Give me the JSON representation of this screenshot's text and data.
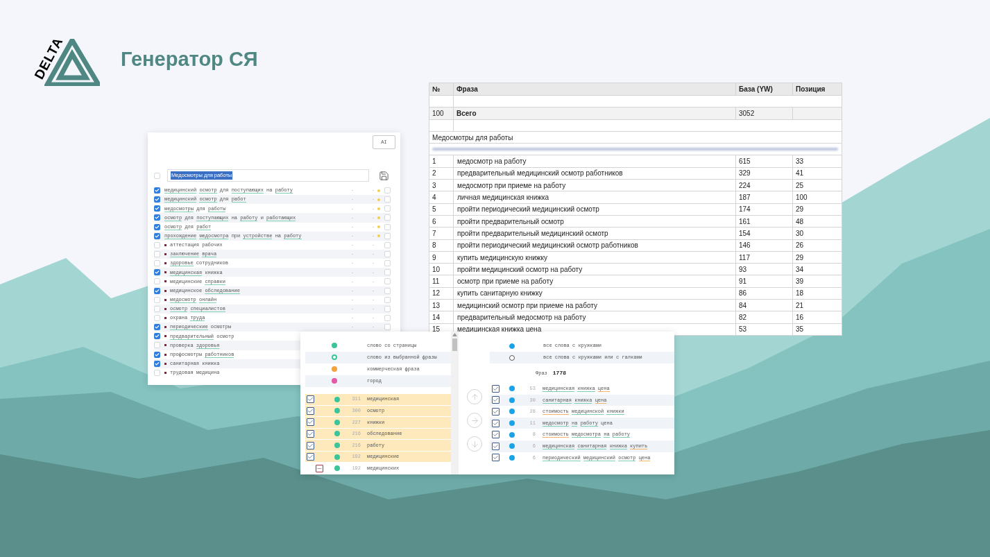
{
  "brand": {
    "logo_text": "DELTA",
    "title": "Генератор СЯ"
  },
  "phrase_editor": {
    "ai_button": "AI",
    "select_all_checked": false,
    "name_field": "Медосмотры для работы",
    "rows": [
      {
        "checked": true,
        "bullet": false,
        "words": [
          {
            "t": "медицинский",
            "color": "#7fd0b3"
          },
          {
            "t": "осмотр",
            "color": "#7fd0b3"
          },
          {
            "t": "для"
          },
          {
            "t": "поступающих",
            "color": "#7fd0b3"
          },
          {
            "t": "на"
          },
          {
            "t": "работу",
            "color": "#7fd0b3"
          }
        ],
        "column_3": "-",
        "column_4": "-",
        "dot": true,
        "flag_checked": false
      },
      {
        "checked": true,
        "bullet": false,
        "words": [
          {
            "t": "медицинский",
            "color": "#7fd0b3"
          },
          {
            "t": "осмотр",
            "color": "#7fd0b3"
          },
          {
            "t": "для"
          },
          {
            "t": "работ",
            "color": "#7fd0b3"
          }
        ],
        "column_3": "-",
        "column_4": "-",
        "dot": true,
        "flag_checked": false
      },
      {
        "checked": true,
        "bullet": false,
        "words": [
          {
            "t": "медосмотры",
            "color": "#7fd0b3"
          },
          {
            "t": "для"
          },
          {
            "t": "работы",
            "color": "#7fd0b3"
          }
        ],
        "column_3": "-",
        "column_4": "-",
        "dot": true,
        "flag_checked": false
      },
      {
        "checked": true,
        "bullet": false,
        "words": [
          {
            "t": "осмотр",
            "color": "#7fd0b3"
          },
          {
            "t": "для"
          },
          {
            "t": "поступающих",
            "color": "#7fd0b3"
          },
          {
            "t": "на"
          },
          {
            "t": "работу",
            "color": "#7fd0b3"
          },
          {
            "t": "и"
          },
          {
            "t": "работающих",
            "color": "#7fd0b3"
          }
        ],
        "column_3": "-",
        "column_4": "-",
        "dot": true,
        "flag_checked": false
      },
      {
        "checked": true,
        "bullet": false,
        "words": [
          {
            "t": "осмотр",
            "color": "#7fd0b3"
          },
          {
            "t": "для"
          },
          {
            "t": "работ",
            "color": "#7fd0b3"
          }
        ],
        "column_3": "-",
        "column_4": "-",
        "dot": true,
        "flag_checked": false
      },
      {
        "checked": true,
        "bullet": false,
        "words": [
          {
            "t": "прохождение",
            "color": "#7fd0b3"
          },
          {
            "t": "медосмотра",
            "color": "#7fd0b3"
          },
          {
            "t": "при"
          },
          {
            "t": "устройстве",
            "color": "#7fd0b3"
          },
          {
            "t": "на"
          },
          {
            "t": "работу",
            "color": "#7fd0b3"
          }
        ],
        "column_3": "-",
        "column_4": "-",
        "dot": true,
        "flag_checked": false
      },
      {
        "checked": false,
        "bullet": true,
        "words": [
          {
            "t": "аттестация"
          },
          {
            "t": "рабочих"
          }
        ],
        "column_3": "-",
        "column_4": "-",
        "dot": false,
        "flag_checked": false
      },
      {
        "checked": false,
        "bullet": true,
        "words": [
          {
            "t": "заключение",
            "color": "#7fd0b3"
          },
          {
            "t": "врача",
            "color": "#7fd0b3"
          }
        ],
        "column_3": "-",
        "column_4": "-",
        "dot": false,
        "flag_checked": false
      },
      {
        "checked": false,
        "bullet": true,
        "words": [
          {
            "t": "здоровье",
            "color": "#7fd0b3"
          },
          {
            "t": "сотрудников"
          }
        ],
        "column_3": "-",
        "column_4": "-",
        "dot": false,
        "flag_checked": false
      },
      {
        "checked": true,
        "bullet": true,
        "words": [
          {
            "t": "медицинская",
            "color": "#7fd0b3"
          },
          {
            "t": "книжка"
          }
        ],
        "column_3": "-",
        "column_4": "-",
        "dot": false,
        "flag_checked": false
      },
      {
        "checked": false,
        "bullet": true,
        "words": [
          {
            "t": "медицинские"
          },
          {
            "t": "справки",
            "color": "#7fd0b3"
          }
        ],
        "column_3": "-",
        "column_4": "-",
        "dot": false,
        "flag_checked": false
      },
      {
        "checked": true,
        "bullet": true,
        "words": [
          {
            "t": "медицинское"
          },
          {
            "t": "обследование",
            "color": "#7fd0b3"
          }
        ],
        "column_3": "-",
        "column_4": "-",
        "dot": false,
        "flag_checked": false
      },
      {
        "checked": false,
        "bullet": true,
        "words": [
          {
            "t": "медосмотр",
            "color": "#7fd0b3"
          },
          {
            "t": "онлайн",
            "color": "#7fd0b3"
          }
        ],
        "column_3": "-",
        "column_4": "-",
        "dot": false,
        "flag_checked": false
      },
      {
        "checked": false,
        "bullet": true,
        "words": [
          {
            "t": "осмотр",
            "color": "#7fd0b3"
          },
          {
            "t": "специалистов",
            "color": "#7fd0b3"
          }
        ],
        "column_3": "-",
        "column_4": "-",
        "dot": false,
        "flag_checked": false
      },
      {
        "checked": false,
        "bullet": true,
        "words": [
          {
            "t": "охрана"
          },
          {
            "t": "труда",
            "color": "#7fd0b3"
          }
        ],
        "column_3": "-",
        "column_4": "-",
        "dot": false,
        "flag_checked": false
      },
      {
        "checked": true,
        "bullet": true,
        "words": [
          {
            "t": "периодические",
            "color": "#7fd0b3"
          },
          {
            "t": "осмотры"
          }
        ],
        "column_3": "-",
        "column_4": "-",
        "dot": false,
        "flag_checked": false
      },
      {
        "checked": true,
        "bullet": true,
        "words": [
          {
            "t": "предварительный",
            "color": "#7fd0b3"
          },
          {
            "t": "осмотр"
          }
        ]
      },
      {
        "checked": false,
        "bullet": true,
        "words": [
          {
            "t": "проверка"
          },
          {
            "t": "здоровья",
            "color": "#7fd0b3"
          }
        ]
      },
      {
        "checked": true,
        "bullet": true,
        "words": [
          {
            "t": "профосмотры"
          },
          {
            "t": "работников",
            "color": "#7fd0b3"
          }
        ]
      },
      {
        "checked": true,
        "bullet": true,
        "words": [
          {
            "t": "санитарная"
          },
          {
            "t": "книжка"
          }
        ]
      },
      {
        "checked": false,
        "bullet": true,
        "words": [
          {
            "t": "трудовая"
          },
          {
            "t": "медицина"
          }
        ]
      }
    ]
  },
  "results_table": {
    "columns": [
      "№",
      "Фраза",
      "База (YW)",
      "Позиция"
    ],
    "rows": [
      {
        "kind": "blank"
      },
      {
        "kind": "total",
        "cells": [
          "100",
          "Всего",
          "3052"
        ]
      },
      {
        "kind": "blank"
      },
      {
        "kind": "group",
        "text": "Медосмотры для работы"
      },
      {
        "kind": "blurred"
      },
      {
        "kind": "data",
        "cells": [
          "1",
          "медосмотр на работу",
          "615",
          "33"
        ]
      },
      {
        "kind": "data",
        "cells": [
          "2",
          "предварительный медицинский осмотр работников",
          "329",
          "41"
        ]
      },
      {
        "kind": "data",
        "cells": [
          "3",
          "медосмотр при приеме на работу",
          "224",
          "25"
        ]
      },
      {
        "kind": "data",
        "cells": [
          "4",
          "личная медицинская книжка",
          "187",
          "100"
        ]
      },
      {
        "kind": "data",
        "cells": [
          "5",
          "пройти периодический медицинский осмотр",
          "174",
          "29"
        ]
      },
      {
        "kind": "data",
        "cells": [
          "6",
          "пройти предварительный осмотр",
          "161",
          "48"
        ]
      },
      {
        "kind": "data",
        "cells": [
          "7",
          "пройти предварительный медицинский осмотр",
          "154",
          "30"
        ]
      },
      {
        "kind": "data",
        "cells": [
          "8",
          "пройти периодический медицинский осмотр работников",
          "146",
          "26"
        ]
      },
      {
        "kind": "data",
        "cells": [
          "9",
          "купить медицинскую книжку",
          "117",
          "29"
        ]
      },
      {
        "kind": "data",
        "cells": [
          "10",
          "пройти медицинский осмотр на работу",
          "93",
          "34"
        ]
      },
      {
        "kind": "data",
        "cells": [
          "11",
          "осмотр при приеме на работу",
          "91",
          "39"
        ]
      },
      {
        "kind": "data",
        "cells": [
          "12",
          "купить санитарную книжку",
          "86",
          "18"
        ]
      },
      {
        "kind": "data",
        "cells": [
          "13",
          "медицинский осмотр при приеме на работу",
          "84",
          "21"
        ]
      },
      {
        "kind": "data",
        "cells": [
          "14",
          "предварительный медосмотр на работу",
          "82",
          "16"
        ]
      },
      {
        "kind": "data",
        "cells": [
          "15",
          "медицинская книжка цена",
          "53",
          "35"
        ]
      }
    ]
  },
  "word_panel": {
    "legend": [
      {
        "label": "слово со страницы",
        "color": "#3cc49a",
        "hollow": false
      },
      {
        "label": "слово из выбранной фразы",
        "color": "#3cc49a",
        "hollow": true
      },
      {
        "label": "коммерческая фраза",
        "color": "#f4a240",
        "hollow": false
      },
      {
        "label": "город",
        "color": "#e657a8",
        "hollow": false
      }
    ],
    "words": [
      {
        "checked": true,
        "highlighted": true,
        "count": "311",
        "word": "медицинская"
      },
      {
        "checked": true,
        "highlighted": true,
        "count": "300",
        "word": "осмотр"
      },
      {
        "checked": true,
        "highlighted": true,
        "count": "227",
        "word": "книжки"
      },
      {
        "checked": true,
        "highlighted": true,
        "count": "216",
        "word": "обследование"
      },
      {
        "checked": true,
        "highlighted": true,
        "count": "216",
        "word": "работу"
      },
      {
        "checked": true,
        "highlighted": true,
        "count": "192",
        "word": "медицинские"
      },
      {
        "indeterminate": true,
        "highlighted": false,
        "count": "192",
        "word": "медицинских"
      }
    ]
  },
  "phrase_panel": {
    "legend": [
      {
        "label": "все слова с кружками",
        "selected": true
      },
      {
        "label": "все слова с кружками или с галками",
        "selected": false
      }
    ],
    "count_label": "Фраз",
    "count": "1778",
    "rows": [
      {
        "checked": true,
        "count": "53",
        "words": [
          {
            "t": "медицинская",
            "color": "#7fd0b3"
          },
          {
            "t": "книжка",
            "color": "#7fd0b3"
          },
          {
            "t": "цена",
            "color": "#f0b46a"
          }
        ]
      },
      {
        "checked": true,
        "count": "30",
        "words": [
          {
            "t": "санитарная",
            "color": "#7fd0b3"
          },
          {
            "t": "книжка",
            "color": "#7fd0b3"
          },
          {
            "t": "цена",
            "color": "#f0b46a"
          }
        ]
      },
      {
        "checked": true,
        "count": "28",
        "words": [
          {
            "t": "стоимость",
            "color": "#f0b46a"
          },
          {
            "t": "медицинской",
            "color": "#7fd0b3"
          },
          {
            "t": "книжки",
            "color": "#7fd0b3"
          }
        ]
      },
      {
        "checked": true,
        "count": "11",
        "words": [
          {
            "t": "медосмотр",
            "color": "#7fd0b3"
          },
          {
            "t": "на",
            "color": "#7fd0b3"
          },
          {
            "t": "работу",
            "color": "#7fd0b3"
          },
          {
            "t": "цена"
          }
        ]
      },
      {
        "checked": true,
        "count": "8",
        "words": [
          {
            "t": "стоимость",
            "color": "#f0b46a"
          },
          {
            "t": "медосмотра",
            "color": "#7fd0b3"
          },
          {
            "t": "на",
            "color": "#7fd0b3"
          },
          {
            "t": "работу",
            "color": "#7fd0b3"
          }
        ]
      },
      {
        "checked": true,
        "count": "6",
        "words": [
          {
            "t": "медицинская",
            "color": "#7fd0b3"
          },
          {
            "t": "санитарная",
            "color": "#7fd0b3"
          },
          {
            "t": "книжка",
            "color": "#7fd0b3"
          },
          {
            "t": "купить",
            "color": "#f0b46a"
          }
        ]
      },
      {
        "checked": true,
        "count": "6",
        "words": [
          {
            "t": "периодический",
            "color": "#7fd0b3"
          },
          {
            "t": "медицинский",
            "color": "#7fd0b3"
          },
          {
            "t": "осмотр",
            "color": "#7fd0b3"
          },
          {
            "t": "цена",
            "color": "#f0b46a"
          }
        ]
      }
    ]
  }
}
